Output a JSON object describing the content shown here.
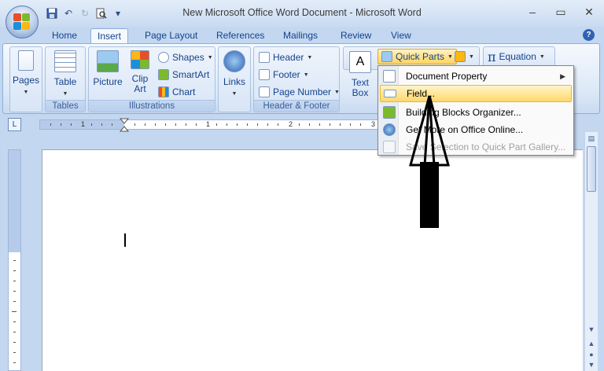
{
  "window": {
    "title": "New Microsoft Office Word Document - Microsoft Word",
    "minimize_glyph": "–",
    "maximize_glyph": "▭",
    "close_glyph": "✕"
  },
  "qat": {
    "save_icon": "save-icon",
    "undo_icon": "undo-icon",
    "redo_icon": "redo-icon",
    "preview_icon": "print-preview-icon",
    "more_glyph": "▾"
  },
  "tabs": [
    {
      "label": "Home"
    },
    {
      "label": "Insert"
    },
    {
      "label": "Page Layout"
    },
    {
      "label": "References"
    },
    {
      "label": "Mailings"
    },
    {
      "label": "Review"
    },
    {
      "label": "View"
    }
  ],
  "help_label": "?",
  "ribbon": {
    "pages": {
      "label": "Pages"
    },
    "tables": {
      "table_label": "Table",
      "group_label": "Tables"
    },
    "illustrations": {
      "picture_label": "Picture",
      "clipart_label": "Clip Art",
      "shapes_label": "Shapes",
      "smartart_label": "SmartArt",
      "chart_label": "Chart",
      "group_label": "Illustrations"
    },
    "links": {
      "label": "Links"
    },
    "header_footer": {
      "header_label": "Header",
      "footer_label": "Footer",
      "page_number_label": "Page Number",
      "group_label": "Header & Footer"
    },
    "text": {
      "textbox_label": "Text Box",
      "quickparts_label": "Quick Parts"
    },
    "symbols": {
      "equation_label": "Equation"
    }
  },
  "quickparts_menu": {
    "items": [
      {
        "label": "Document Property",
        "has_submenu": true,
        "enabled": true
      },
      {
        "label": "Field...",
        "highlighted": true,
        "enabled": true
      },
      {
        "label": "Building Blocks Organizer...",
        "enabled": true
      },
      {
        "label": "Get More on Office Online...",
        "enabled": true
      },
      {
        "label": "Save Selection to Quick Part Gallery...",
        "enabled": false
      }
    ]
  },
  "ruler": {
    "labels": [
      "1",
      "1",
      "2",
      "3"
    ]
  },
  "colors": {
    "accent": "#15428b",
    "ribbon_bg": "#dce8f7",
    "highlight": "#ffd86b"
  }
}
